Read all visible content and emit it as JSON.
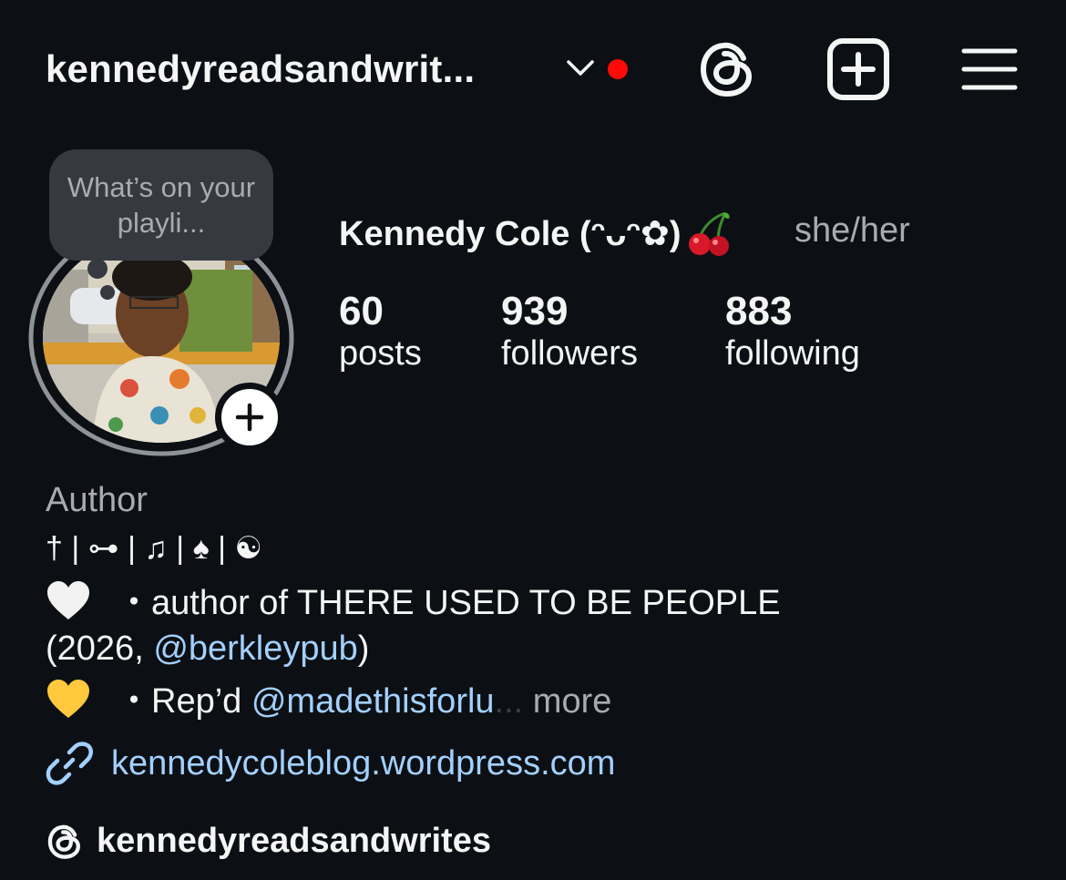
{
  "header": {
    "username": "kennedyreadsandwrit...",
    "notification_color": "#ff0a0a",
    "icons": [
      "chevron-down-icon",
      "threads-icon",
      "create-plus-icon",
      "menu-icon"
    ]
  },
  "note": {
    "text": "What’s on your playli..."
  },
  "profile": {
    "display_name": "Kennedy Cole (ᵔᴗᵔ✿)",
    "pronouns": "she/her",
    "stats": [
      {
        "value": "60",
        "label": "posts"
      },
      {
        "value": "939",
        "label": "followers"
      },
      {
        "value": "883",
        "label": "following"
      }
    ]
  },
  "bio": {
    "category": "Author",
    "symbols": "† | ⊶ | ♫ | ♠ | ☯",
    "line1": "・author of THERE USED TO BE PEOPLE",
    "line2_pre": "(2026, ",
    "line2_mention": "@berkleypub",
    "line2_post": ")",
    "line3_pre": "・Rep’d ",
    "line3_mention": "@madethisforlu",
    "line3_ellipsis": "...",
    "line3_more": " more",
    "website": "kennedycoleblog.wordpress.com",
    "threads_handle": "kennedyreadsandwrites"
  },
  "colors": {
    "background": "#0c1014",
    "link": "#a3d0ff",
    "muted": "#a8acb2"
  }
}
